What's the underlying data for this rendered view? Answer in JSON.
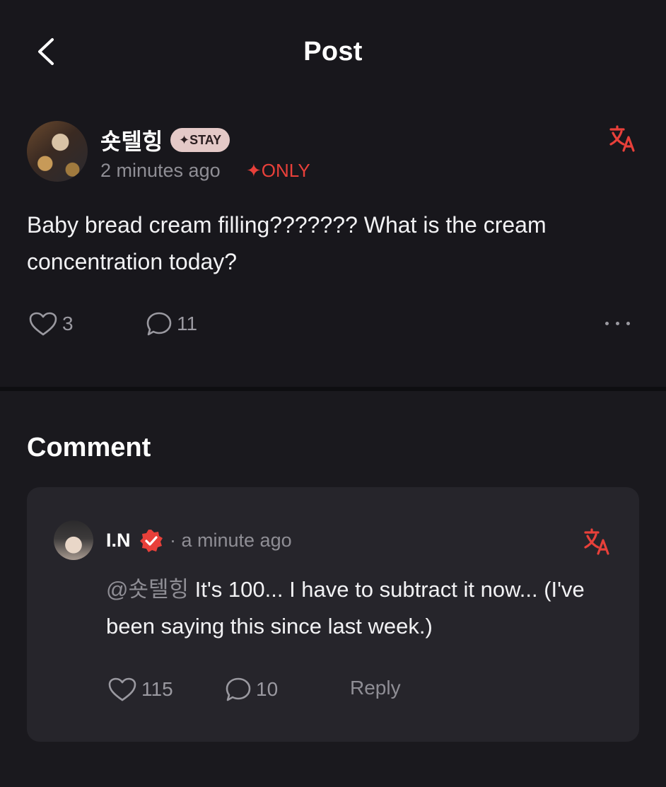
{
  "header": {
    "title": "Post"
  },
  "post": {
    "username": "숏텔힝",
    "badge": "✦STAY",
    "time": "2 minutes ago",
    "only_label": "✦ONLY",
    "text": "Baby bread cream filling??????? What is the cream concentration today?",
    "likes": "3",
    "comments": "11"
  },
  "comment_section": {
    "heading": "Comment"
  },
  "comment": {
    "username": "I.N",
    "time": "· a minute ago",
    "mention": "@숏텔힝",
    "text": " It's 100... I have to subtract it now... (I've been saying this since last week.)",
    "likes": "115",
    "replies": "10",
    "reply_label": "Reply"
  },
  "colors": {
    "background": "#18171c",
    "card": "#26252b",
    "accent_red": "#e8403a",
    "badge_pink": "#e4c9c7",
    "muted_text": "#8f8e95"
  },
  "icons": [
    "back-chevron-icon",
    "translate-icon",
    "heart-icon",
    "comment-bubble-icon",
    "more-dots-icon",
    "verified-icon"
  ]
}
